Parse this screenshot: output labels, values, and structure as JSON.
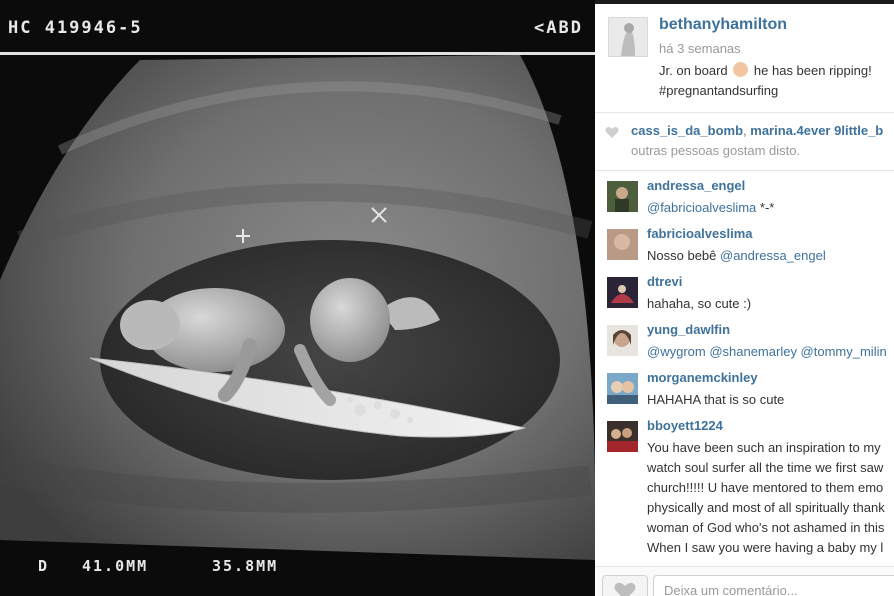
{
  "photo": {
    "patient_id": "HC 419946-5",
    "region_label": "<ABD",
    "depth_label": "D",
    "measure_1": "41.0MM",
    "measure_2": "35.8MM"
  },
  "post": {
    "username": "bethanyhamilton",
    "time_ago": "há 3 semanas",
    "caption_part_1": "Jr. on board",
    "caption_part_2": "he has been ripping!",
    "hashtag": "#pregnantandsurfing"
  },
  "likes": {
    "user_1": "cass_is_da_bomb",
    "separator": ",",
    "user_2": "marina.4ever",
    "user_3": "9little_b",
    "suffix": "outras pessoas gostam disto."
  },
  "comments": [
    {
      "user": "andressa_engel",
      "mention": "@fabricioalveslima",
      "text": " *-*"
    },
    {
      "user": "fabricioalveslima",
      "text": "Nosso bebê ",
      "mention": "@andressa_engel"
    },
    {
      "user": "dtrevi",
      "text": "hahaha, so cute :)"
    },
    {
      "user": "yung_dawlfin",
      "mentions": "@wygrom @shanemarley @tommy_milin"
    },
    {
      "user": "morganemckinley",
      "text": "HAHAHA that is so cute"
    },
    {
      "user": "bboyett1224",
      "lines": [
        "You have been such an inspiration to my",
        "watch soul surfer all the time we first saw",
        "church!!!!! U have mentored to them emo",
        "physically and most of all spiritually thank",
        "woman of God who's not ashamed in this",
        "When I saw you were having a baby my l",
        "                                                                  "
      ]
    }
  ],
  "footer": {
    "placeholder": "Deixa um comentário..."
  },
  "colors": {
    "username_blue": "#3f729b",
    "muted_gray": "#9a9a9a"
  }
}
